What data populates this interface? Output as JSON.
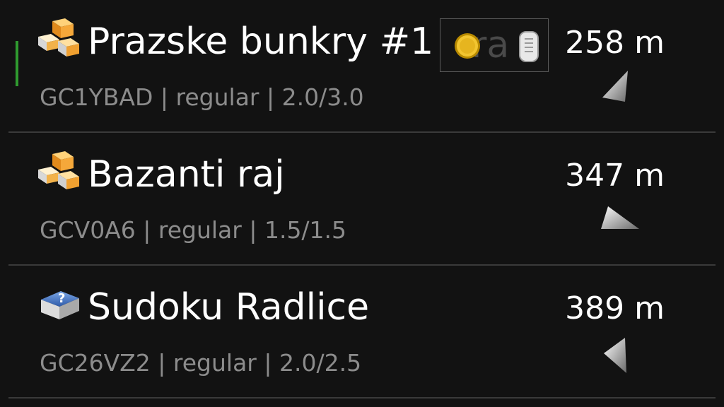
{
  "caches": [
    {
      "name": "Prazske bunkry #1 - ",
      "name_overlap_text": "ra",
      "code": "GC1YBAD",
      "container": "regular",
      "rating": "2.0/3.0",
      "separator": " | ",
      "distance": "258 m",
      "type_icon": "traditional-cache-icon",
      "arrow_icon": "direction-arrow-icon",
      "highlighted": true,
      "inventory_icons": [
        "coin-icon",
        "travel-bug-icon"
      ]
    },
    {
      "name": "Bazanti raj",
      "code": "GCV0A6",
      "container": "regular",
      "rating": "1.5/1.5",
      "separator": " | ",
      "distance": "347 m",
      "type_icon": "traditional-cache-icon",
      "arrow_icon": "direction-arrow-icon",
      "highlighted": false
    },
    {
      "name": "Sudoku Radlice",
      "code": "GC26VZ2",
      "container": "regular",
      "rating": "2.0/2.5",
      "separator": " | ",
      "distance": "389 m",
      "type_icon": "mystery-cache-icon",
      "arrow_icon": "direction-arrow-icon",
      "highlighted": false
    }
  ],
  "colors": {
    "background": "#121212",
    "title": "#ffffff",
    "meta": "#8c8c8c",
    "highlight_bar": "#2f9a2f",
    "traditional_orange": "#f0a030",
    "mystery_blue": "#4a78c0"
  }
}
